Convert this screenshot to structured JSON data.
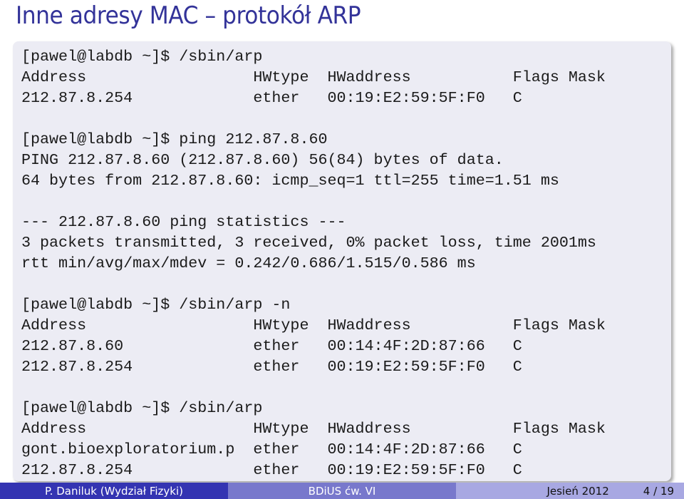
{
  "slide": {
    "title": "Inne adresy MAC – protokół ARP",
    "terminal_lines": [
      "[pawel@labdb ~]$ /sbin/arp",
      "Address                  HWtype  HWaddress           Flags Mask",
      "212.87.8.254             ether   00:19:E2:59:5F:F0   C",
      "",
      "[pawel@labdb ~]$ ping 212.87.8.60",
      "PING 212.87.8.60 (212.87.8.60) 56(84) bytes of data.",
      "64 bytes from 212.87.8.60: icmp_seq=1 ttl=255 time=1.51 ms",
      "",
      "--- 212.87.8.60 ping statistics ---",
      "3 packets transmitted, 3 received, 0% packet loss, time 2001ms",
      "rtt min/avg/max/mdev = 0.242/0.686/1.515/0.586 ms",
      "",
      "[pawel@labdb ~]$ /sbin/arp -n",
      "Address                  HWtype  HWaddress           Flags Mask",
      "212.87.8.60              ether   00:14:4F:2D:87:66   C",
      "212.87.8.254             ether   00:19:E2:59:5F:F0   C",
      "",
      "[pawel@labdb ~]$ /sbin/arp",
      "Address                  HWtype  HWaddress           Flags Mask",
      "gont.bioexploratorium.p  ether   00:14:4F:2D:87:66   C",
      "212.87.8.254             ether   00:19:E2:59:5F:F0   C"
    ]
  },
  "footer": {
    "author": "P. Daniluk (Wydział Fizyki)",
    "course": "BDiUS ćw. VI",
    "date": "Jesień 2012",
    "page": "4 / 19"
  },
  "colors": {
    "title": "#333399",
    "footer_dark": "#3434b2",
    "footer_mid": "#7878cc",
    "footer_light": "#a8a8e2",
    "box": "#ececf4"
  }
}
